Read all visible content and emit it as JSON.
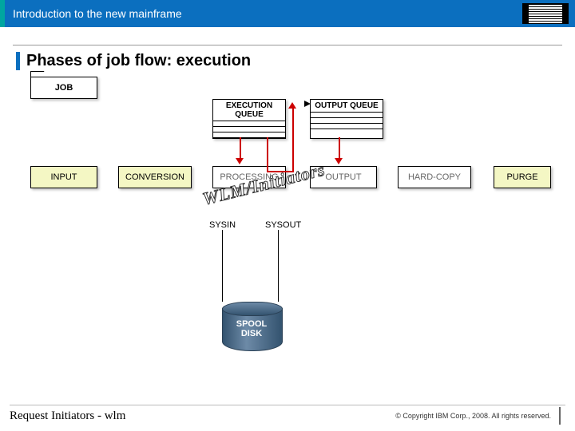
{
  "header": {
    "title": "Introduction to the new mainframe",
    "logo_alt": "IBM"
  },
  "slide": {
    "title": "Phases of job flow: execution"
  },
  "boxes": {
    "job": "JOB",
    "input": "INPUT",
    "conversion": "CONVERSION",
    "processing": "PROCESSING",
    "output": "OUTPUT",
    "hardcopy": "HARD-COPY",
    "purge": "PURGE"
  },
  "queues": {
    "execution": "EXECUTION QUEUE",
    "output": "OUTPUT QUEUE"
  },
  "labels": {
    "sysin": "SYSIN",
    "sysout": "SYSOUT",
    "spool_line1": "SPOOL",
    "spool_line2": "DISK",
    "wlm": "WLM/Initiators"
  },
  "footer": {
    "left": "Request Initiators - wlm",
    "copyright": "© Copyright IBM Corp., 2008. All rights reserved."
  }
}
